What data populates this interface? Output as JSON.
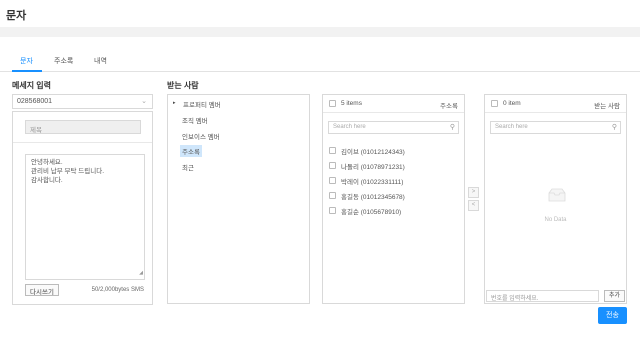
{
  "page": {
    "title": "문자"
  },
  "tabs": [
    {
      "label": "문자"
    },
    {
      "label": "주소록"
    },
    {
      "label": "내역"
    }
  ],
  "message_input": {
    "title": "메세지 입력",
    "sender_number": "028568001",
    "subject_placeholder": "제목",
    "body_lines": [
      "안녕하세요.",
      "관리비 납부 부탁 드립니다.",
      "감사합니다."
    ],
    "reload_label": "다시쓰기",
    "byte_counter": "50/2,000bytes",
    "msg_type": "SMS"
  },
  "recipients": {
    "title": "받는 사람",
    "tree": [
      {
        "label": "프로퍼티 멤버",
        "caret": "▸"
      },
      {
        "label": "조직 멤버"
      },
      {
        "label": "인보이스 멤버"
      },
      {
        "label": "주소록",
        "selected": true
      },
      {
        "label": "최근"
      }
    ]
  },
  "address_list": {
    "count": "5 items",
    "title": "주소록",
    "search_placeholder": "Search here",
    "contacts": [
      "김이브 (01012124343)",
      "나돌리 (01078971231)",
      "박레이 (01022331111)",
      "홍길동 (01012345678)",
      "홍길순 (0105678910)"
    ]
  },
  "transfer": {
    "right": ">",
    "left": "<"
  },
  "receiver_list": {
    "count": "0 item",
    "title": "받는 사람",
    "search_placeholder": "Search here",
    "empty_text": "No Data",
    "phone_placeholder": "번호를 입력하세요.",
    "add_label": "추가"
  },
  "send_label": "전송",
  "colors": {
    "accent": "#1890ff",
    "selected_bg": "#cfe6fb"
  }
}
